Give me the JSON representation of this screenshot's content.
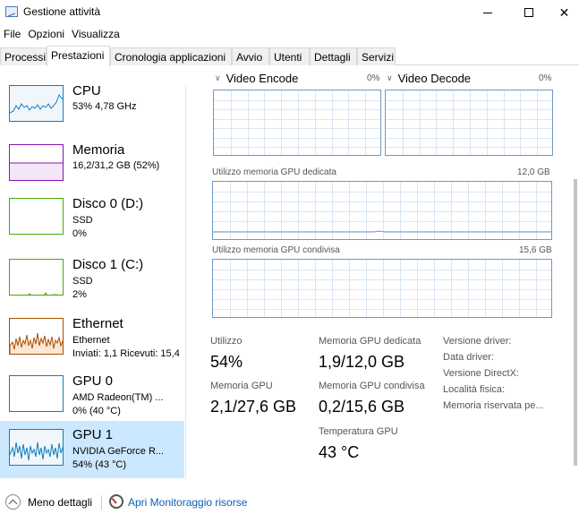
{
  "window": {
    "title": "Gestione attività"
  },
  "menu": [
    "File",
    "Opzioni",
    "Visualizza"
  ],
  "tabs": [
    "Processi",
    "Prestazioni",
    "Cronologia applicazioni",
    "Avvio",
    "Utenti",
    "Dettagli",
    "Servizi"
  ],
  "active_tab": "Prestazioni",
  "sidebar": {
    "items": [
      {
        "title": "CPU",
        "line1": "53% 4,78 GHz",
        "line2": "",
        "color": "#117dbb"
      },
      {
        "title": "Memoria",
        "line1": "16,2/31,2 GB (52%)",
        "line2": "",
        "color": "#8b12ae"
      },
      {
        "title": "Disco 0 (D:)",
        "line1": "SSD",
        "line2": "0%",
        "color": "#4da60c"
      },
      {
        "title": "Disco 1 (C:)",
        "line1": "SSD",
        "line2": "2%",
        "color": "#4da60c"
      },
      {
        "title": "Ethernet",
        "line1": "Ethernet",
        "line2": "Inviati: 1,1 Ricevuti: 15,4",
        "color": "#a74f01"
      },
      {
        "title": "GPU 0",
        "line1": "AMD Radeon(TM) ...",
        "line2": "0% (40 °C)",
        "color": "#117dbb"
      },
      {
        "title": "GPU 1",
        "line1": "NVIDIA GeForce R...",
        "line2": "54% (43 °C)",
        "color": "#117dbb"
      }
    ]
  },
  "engines": {
    "left": {
      "name": "Video Encode",
      "pct": "0%"
    },
    "right": {
      "name": "Video Decode",
      "pct": "0%"
    }
  },
  "dedicated_graph": {
    "label": "Utilizzo memoria GPU dedicata",
    "max": "12,0 GB"
  },
  "shared_graph": {
    "label": "Utilizzo memoria GPU condivisa",
    "max": "15,6 GB"
  },
  "stats": {
    "utilizzo_label": "Utilizzo",
    "utilizzo_value": "54%",
    "memoria_gpu_label": "Memoria GPU",
    "memoria_gpu_value": "2,1/27,6 GB",
    "dedicata_label": "Memoria GPU dedicata",
    "dedicata_value": "1,9/12,0 GB",
    "condivisa_label": "Memoria GPU condivisa",
    "condivisa_value": "0,2/15,6 GB",
    "temp_label": "Temperatura GPU",
    "temp_value": "43 °C"
  },
  "info_labels": [
    "Versione driver:",
    "Data driver:",
    "Versione DirectX:",
    "Località fisica:",
    "Memoria riservata pe..."
  ],
  "footer": {
    "less_details": "Meno dettagli",
    "monitor_link": "Apri Monitoraggio risorse"
  },
  "colors": {
    "gpu_graph_border": "#6e98c8",
    "selected_bg": "#cce8ff",
    "link": "#0b5fb5"
  }
}
